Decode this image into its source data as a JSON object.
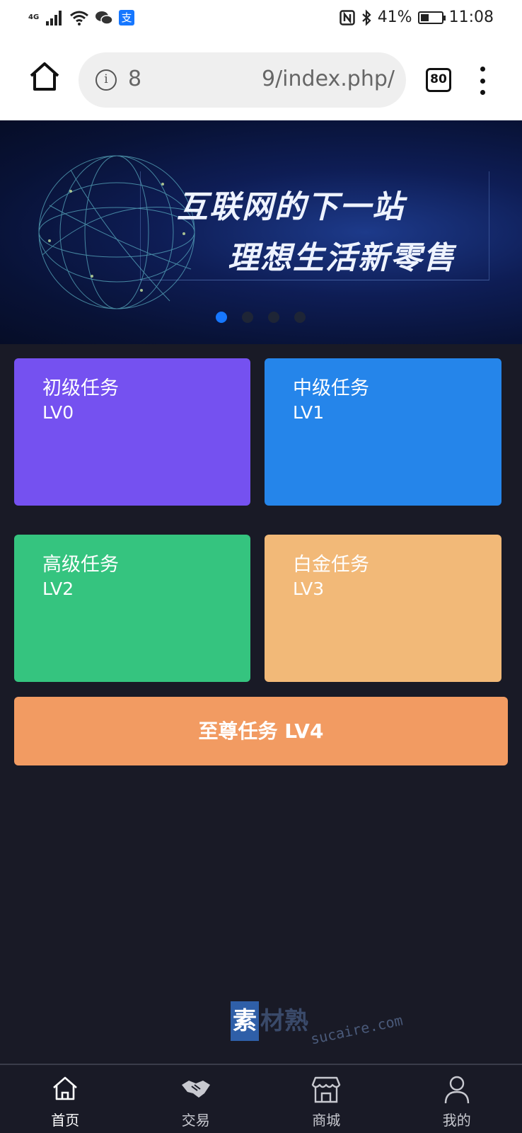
{
  "status_bar": {
    "network": "4G",
    "battery_text": "41%",
    "battery_level": 0.41,
    "time": "11:08",
    "alipay_glyph": "支"
  },
  "browser": {
    "url": "9/index.php/",
    "url_prefix": "8",
    "tabs_count": "80"
  },
  "banner": {
    "line1": "互联网的下一站",
    "line2": "理想生活新零售",
    "slide_count": 4,
    "active_slide": 0
  },
  "tasks": [
    {
      "title": "初级任务",
      "level": "LV0",
      "color": "#7551f0"
    },
    {
      "title": "中级任务",
      "level": "LV1",
      "color": "#2585ea"
    },
    {
      "title": "高级任务",
      "level": "LV2",
      "color": "#35c47f"
    },
    {
      "title": "白金任务",
      "level": "LV3",
      "color": "#f2b978"
    }
  ],
  "supreme_task": {
    "label": "至尊任务 LV4",
    "color": "#f29b62"
  },
  "watermark": {
    "box_char": "素",
    "rest": "材熟",
    "url": "sucaire.com"
  },
  "bottom_nav": [
    {
      "label": "首页",
      "icon": "home-icon",
      "active": true
    },
    {
      "label": "交易",
      "icon": "handshake-icon",
      "active": false
    },
    {
      "label": "商城",
      "icon": "shop-icon",
      "active": false
    },
    {
      "label": "我的",
      "icon": "user-icon",
      "active": false
    }
  ]
}
